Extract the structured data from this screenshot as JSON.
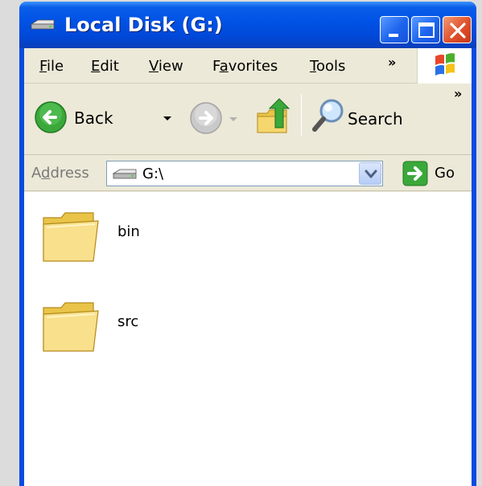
{
  "window": {
    "title": "Local Disk (G:)"
  },
  "menu": {
    "items": [
      {
        "label": "File",
        "mnemonic": "F",
        "rest": "ile"
      },
      {
        "label": "Edit",
        "mnemonic": "E",
        "rest": "dit"
      },
      {
        "label": "View",
        "mnemonic": "V",
        "rest": "iew"
      },
      {
        "label": "Favorites",
        "pre": "F",
        "mnemonic": "a",
        "rest": "vorites"
      },
      {
        "label": "Tools",
        "mnemonic": "T",
        "rest": "ools"
      }
    ],
    "overflow": "»"
  },
  "toolbar": {
    "back_label": "Back",
    "search_label": "Search",
    "overflow": "»"
  },
  "address": {
    "label_pre": "A",
    "label_mnemonic": "d",
    "label_rest": "dress",
    "value": "G:\\",
    "go_label": "Go"
  },
  "files": [
    {
      "name": "bin",
      "icon": "folder-icon"
    },
    {
      "name": "src",
      "icon": "folder-icon"
    }
  ],
  "colors": {
    "titlebar": "#0053e6",
    "window_frame": "#0a4be0",
    "chrome": "#ece9d8",
    "close_button": "#e0502a",
    "back_arrow": "#3aa83a",
    "go_arrow": "#3aa83a",
    "folder": "#f5d76e"
  }
}
